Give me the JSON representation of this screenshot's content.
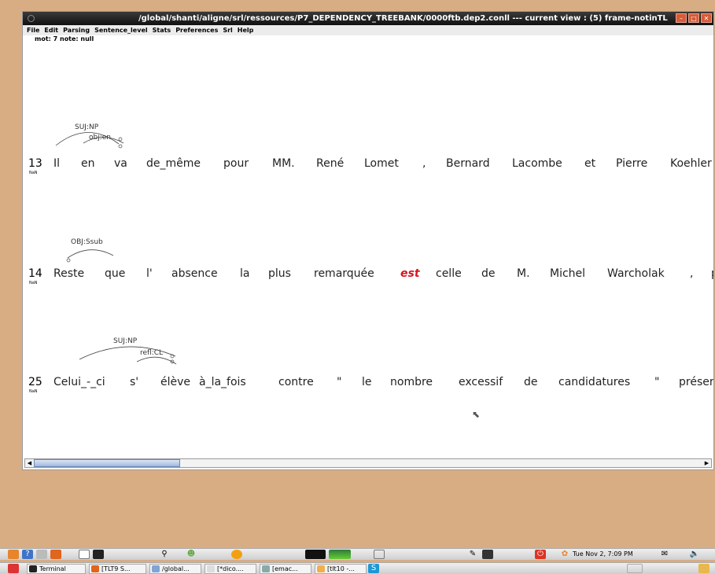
{
  "window": {
    "title": "/global/shanti/aligne/srl/ressources/P7_DEPENDENCY_TREEBANK/0000ftb.dep2.conll --- current view : (5) frame-notinTL",
    "title_left": "/global/sh",
    "status": "mot: 7 note: null"
  },
  "menu": [
    "File",
    "Edit",
    "Parsing",
    "Sentence_level",
    "Stats",
    "Preferences",
    "Srl",
    "Help"
  ],
  "sentences": [
    {
      "num": "13",
      "tag": "NaN",
      "words": [
        "Il",
        "en",
        "va",
        "de_même",
        "pour",
        "MM.",
        "René",
        "Lomet",
        ",",
        "Bernard",
        "Lacombe",
        "et",
        "Pierre",
        "Koehler"
      ],
      "arcs": [
        {
          "label": "SUJ:NP"
        },
        {
          "label": "obj:en"
        }
      ]
    },
    {
      "num": "14",
      "tag": "NaN",
      "words": [
        "Reste",
        "que",
        "l'",
        "absence",
        "la",
        "plus",
        "remarquée",
        "est",
        "celle",
        "de",
        "M.",
        "Michel",
        "Warcholak",
        ",",
        "p"
      ],
      "arcs": [
        {
          "label": "OBJ:Ssub"
        }
      ]
    },
    {
      "num": "25",
      "tag": "NaN",
      "words": [
        "Celui_-_ci",
        "s'",
        "élève",
        "à_la_fois",
        "contre",
        "\"",
        "le",
        "nombre",
        "excessif",
        "de",
        "candidatures",
        "\"",
        "préser"
      ],
      "arcs": [
        {
          "label": "SUJ:NP"
        },
        {
          "label": "refl:CL"
        }
      ]
    }
  ],
  "taskbar": {
    "clock": "Tue Nov  2, 7:09 PM",
    "tasks": [
      "Terminal",
      "[TLT9 S...",
      "/global...",
      "[*dico....",
      "[emac...",
      "[tlt10 -..."
    ]
  },
  "colors": {
    "predicate": "#d8141e",
    "desktop": "#d8ad84",
    "scroll_thumb": "#9fb7dc"
  },
  "icons": [
    "ubuntu-menu-icon",
    "help-icon",
    "firefox-icon",
    "terminal-icon",
    "search-icon",
    "network-icon",
    "power-icon",
    "ubuntu-logo-icon",
    "mail-icon",
    "volume-icon"
  ]
}
